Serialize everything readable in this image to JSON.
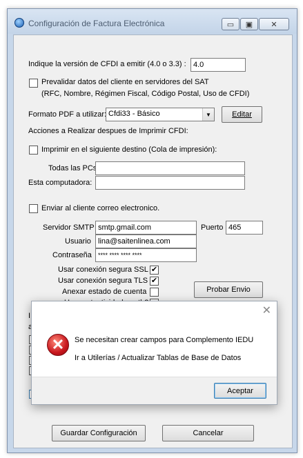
{
  "window": {
    "title": "Configuración de Factura Electrónica",
    "min_glyph": "▭",
    "max_glyph": "▣",
    "close_glyph": "✕"
  },
  "cfdi": {
    "label": "Indique la versión de CFDI a emitir (4.0 o 3.3) :",
    "value": "4.0"
  },
  "prevalidar": {
    "checked": false,
    "label": "Prevalidar datos del cliente en servidores del SAT",
    "sublabel": "(RFC, Nombre, Régimen Fiscal, Código Postal, Uso de CFDI)"
  },
  "formato": {
    "label": "Formato PDF a utilizar:",
    "value": "Cfdi33 - Básico",
    "edit_button": "Editar"
  },
  "acciones": {
    "label": "Acciones a Realizar despues de Imprimir CFDI:",
    "imprimir_label": "Imprimir en el siguiente destino (Cola de impresión):",
    "imprimir_checked": false,
    "todas_label": "Todas las PCs:",
    "todas_value": "",
    "esta_label": "Esta computadora:",
    "esta_value": ""
  },
  "correo": {
    "enviar_label": "Enviar al cliente correo electronico.",
    "enviar_checked": false,
    "smtp_label": "Servidor SMTP",
    "smtp_value": "smtp.gmail.com",
    "puerto_label": "Puerto",
    "puerto_value": "465",
    "usuario_label": "Usuario",
    "usuario_value": "lina@saitenlinea.com",
    "password_label": "Contraseña",
    "password_value": "**** **** **** ****",
    "ssl_label": "Usar conexión segura SSL",
    "ssl_checked": true,
    "tls_label": "Usar conexión segura TLS",
    "tls_checked": true,
    "anexar_label": "Anexar estado de cuenta",
    "anexar_checked": false,
    "oauth_label": "Usar autenticidad oauth2",
    "oauth_checked": false,
    "probar_button": "Probar Envio"
  },
  "footer": {
    "guardar_button": "Guardar Configuración",
    "cancelar_button": "Cancelar"
  },
  "hidden_fragments": {
    "line1": "I",
    "line2": "a"
  },
  "dialog": {
    "close_glyph": "✕",
    "error_glyph": "✕",
    "message1": "Se necesitan crear campos para Complemento IEDU",
    "message2": "Ir a Utilerías / Actualizar Tablas de Base de Datos",
    "accept_button": "Aceptar"
  },
  "colors": {
    "titlebar": "#c7d7ea",
    "client_bg": "#f0f0f0",
    "error_red": "#c8161d",
    "focus_blue": "#3c7fb1"
  },
  "icons": [
    "app-icon",
    "minimize-icon",
    "maximize-icon",
    "close-icon",
    "dropdown-arrow-icon",
    "error-icon",
    "checkmark-icon"
  ]
}
